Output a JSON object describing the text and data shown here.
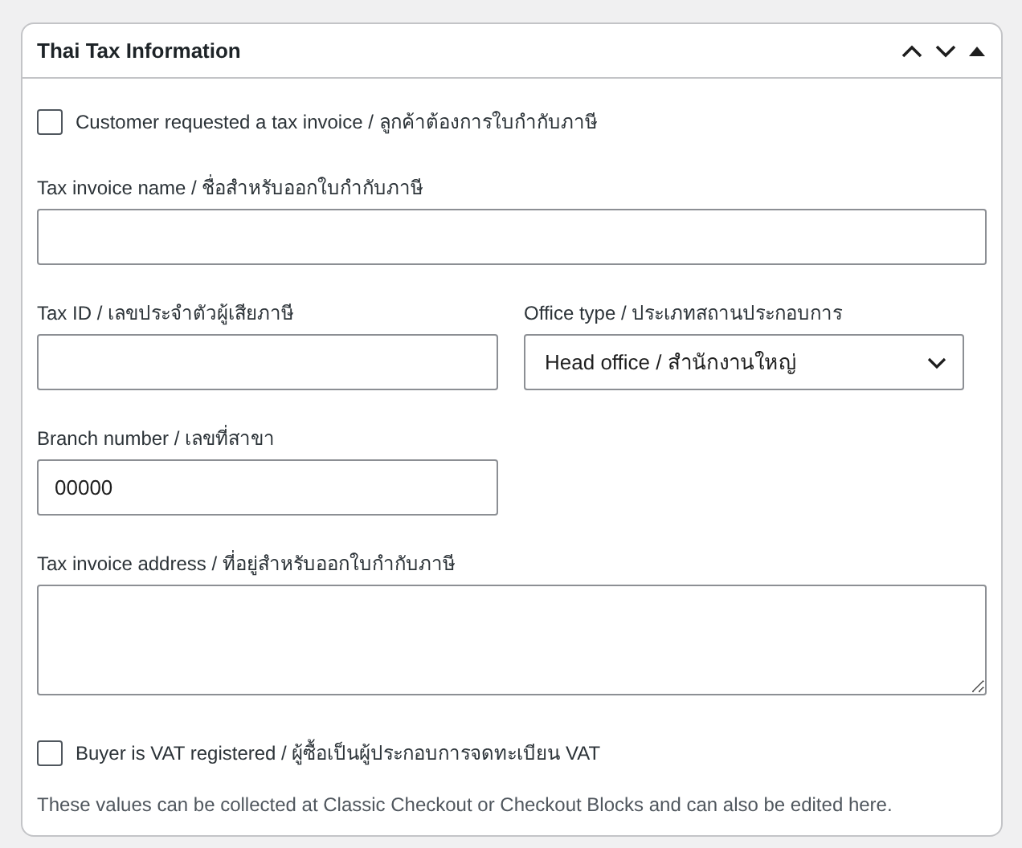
{
  "title": "Thai Tax Information",
  "rows": [
    [
      {
        "kind": "checkbox",
        "label": "Customer requested a tax invoice / ลูกค้าต้องการใบกำกับภาษี",
        "checked": false
      }
    ],
    [
      {
        "kind": "text",
        "label": "Tax invoice name / ชื่อสำหรับออกใบกำกับภาษี"
      }
    ],
    [
      {
        "kind": "text",
        "label": "Tax ID / เลขประจำตัวผู้เสียภาษี"
      },
      {
        "kind": "select",
        "label": "Office type / ประเภทสถานประกอบการ",
        "value": "Head office / สำนักงานใหญ่"
      }
    ],
    [
      {
        "kind": "text",
        "label": "Branch number / เลขที่สาขา",
        "value": "00000"
      }
    ],
    [
      {
        "kind": "textarea",
        "label": "Tax invoice address / ที่อยู่สำหรับออกใบกำกับภาษี"
      }
    ],
    [
      {
        "kind": "checkbox",
        "label": "Buyer is VAT registered / ผู้ซื้อเป็นผู้ประกอบการจดทะเบียน VAT",
        "checked": false
      }
    ],
    [
      {
        "kind": "note",
        "text": "These values can be collected at Classic Checkout or Checkout Blocks and can also be edited here."
      }
    ]
  ]
}
